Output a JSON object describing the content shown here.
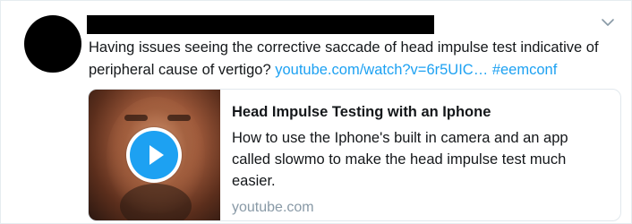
{
  "tweet": {
    "text_main": "Having issues seeing the corrective saccade of head impulse test indicative of peripheral cause of vertigo? ",
    "link": "youtube.com/watch?v=6r5UIC…",
    "hashtag": "#eemconf"
  },
  "card": {
    "title": "Head Impulse Testing with an Iphone",
    "description": "How to use the Iphone's built in camera and an app called slowmo to make the head impulse test much easier.",
    "domain": "youtube.com"
  },
  "icons": {
    "caret": "chevron-down-icon",
    "play": "play-icon"
  },
  "colors": {
    "accent": "#1da1f2",
    "text": "#14171a",
    "muted": "#8899a6"
  }
}
